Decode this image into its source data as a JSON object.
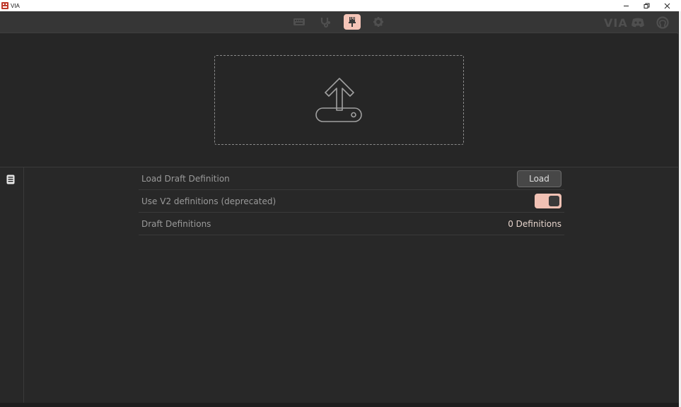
{
  "window": {
    "title": "VIA",
    "minimize_icon": "minimize-icon",
    "restore_icon": "restore-icon",
    "close_icon": "close-icon"
  },
  "toolbar": {
    "tabs": [
      {
        "name": "keyboard-icon",
        "active": false
      },
      {
        "name": "stethoscope-icon",
        "active": false
      },
      {
        "name": "paintbrush-icon",
        "active": true
      },
      {
        "name": "gear-icon",
        "active": false
      }
    ],
    "right": {
      "logo": "VIA",
      "discord_icon": "discord-icon",
      "github_icon": "github-icon"
    }
  },
  "dropzone": {
    "icon": "upload-icon"
  },
  "sidebar": {
    "icon": "keyboard-file-icon"
  },
  "settings": {
    "rows": [
      {
        "label": "Load Draft Definition",
        "control": "button",
        "button_label": "Load"
      },
      {
        "label": "Use V2 definitions (deprecated)",
        "control": "toggle",
        "enabled": true
      },
      {
        "label": "Draft Definitions",
        "control": "value",
        "value": "0 Definitions"
      }
    ]
  },
  "colors": {
    "accent": "#f5c5b8",
    "background": "#262626",
    "toolbar": "#363636",
    "label": "#9a9a9a"
  }
}
